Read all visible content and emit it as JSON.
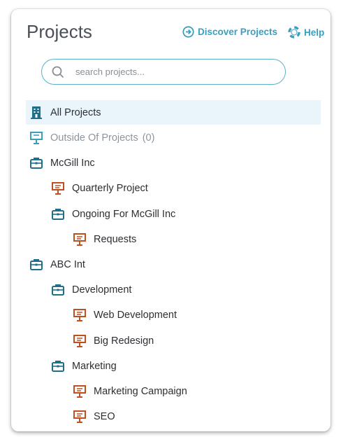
{
  "header": {
    "title": "Projects",
    "discover_label": "Discover Projects",
    "help_label": "Help"
  },
  "search": {
    "placeholder": "search projects..."
  },
  "colors": {
    "accent": "#3a9fbf",
    "folder": "#1f6f8b",
    "project": "#c0501f"
  },
  "tree": {
    "all_projects": "All Projects",
    "outside": {
      "label": "Outside Of Projects",
      "count": "(0)"
    },
    "mcgill": "McGill Inc",
    "quarterly": "Quarterly Project",
    "ongoing": "Ongoing For McGill Inc",
    "requests": "Requests",
    "abc": "ABC Int",
    "development": "Development",
    "web_dev": "Web Development",
    "big_redesign": "Big Redesign",
    "marketing": "Marketing",
    "marketing_campaign": "Marketing Campaign",
    "seo": "SEO"
  }
}
